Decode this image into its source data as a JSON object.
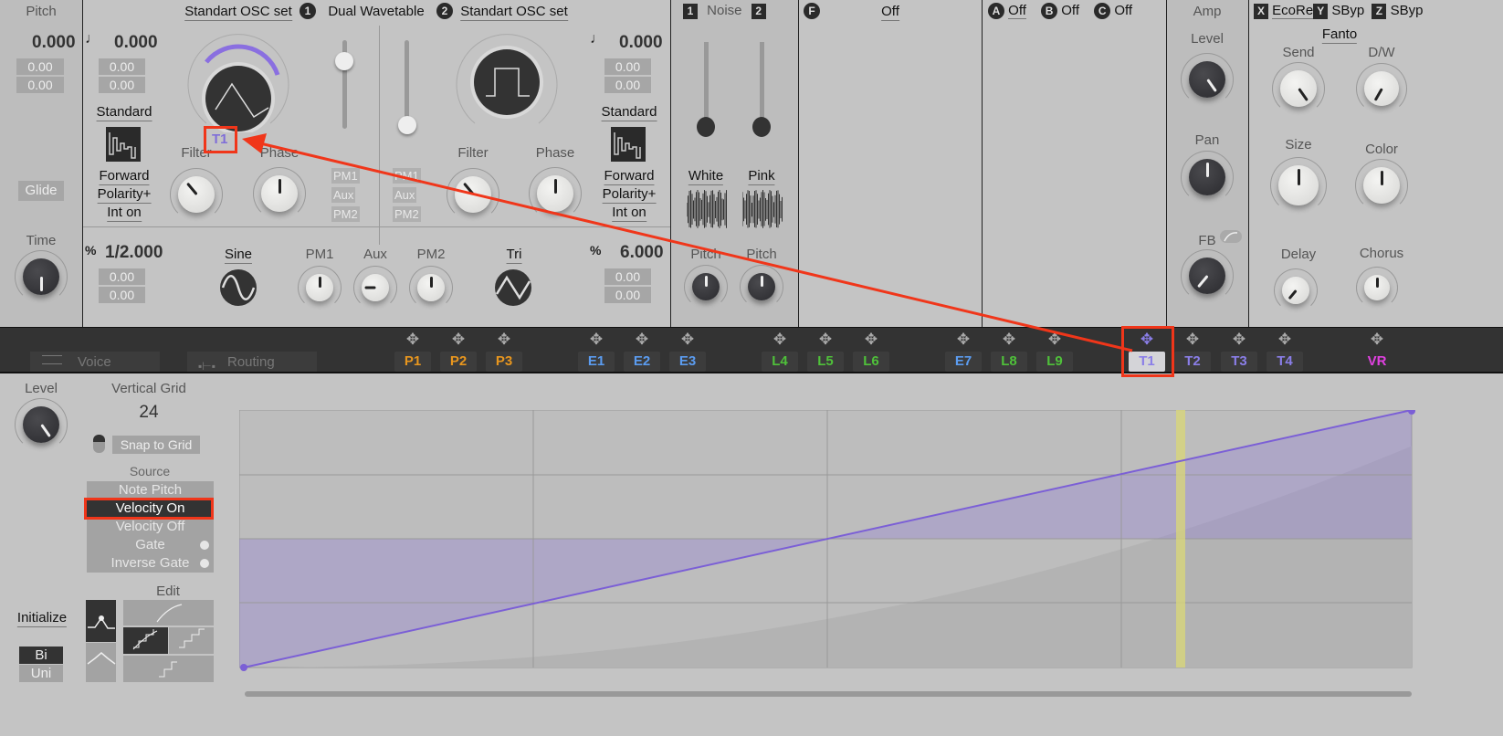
{
  "pitch": {
    "title": "Pitch",
    "value": "0.000",
    "fine1": "0.00",
    "fine2": "0.00",
    "glide": "Glide",
    "time": "Time"
  },
  "osc_header": {
    "osc1_set": "Standart OSC set",
    "num1": "1",
    "mode": "Dual Wavetable",
    "num2": "2",
    "osc2_set": "Standart OSC set"
  },
  "osc1": {
    "note_icon": "♩",
    "value": "0.000",
    "fine1": "0.00",
    "fine2": "0.00",
    "type": "Standard",
    "direction": "Forward",
    "polarity": "Polarity+",
    "interp": "Int on",
    "mod_label": "T1",
    "filter": "Filter",
    "phase": "Phase",
    "pct_icon": "%",
    "ratio": "1/2.000",
    "rfine1": "0.00",
    "rfine2": "0.00"
  },
  "osc2": {
    "note_icon": "♩",
    "value": "0.000",
    "fine1": "0.00",
    "fine2": "0.00",
    "type": "Standard",
    "direction": "Forward",
    "polarity": "Polarity+",
    "interp": "Int on",
    "filter": "Filter",
    "phase": "Phase",
    "pct_icon": "%",
    "ratio": "6.000",
    "rfine1": "0.00",
    "rfine2": "0.00"
  },
  "tags1": [
    "PM1",
    "Aux",
    "PM2"
  ],
  "tags2": [
    "PM1",
    "Aux",
    "PM2"
  ],
  "sub": {
    "wave1": "Sine",
    "pm1": "PM1",
    "aux": "Aux",
    "pm2": "PM2",
    "wave2": "Tri"
  },
  "noise": {
    "n1": "1",
    "title": "Noise",
    "n2": "2",
    "white": "White",
    "pink": "Pink",
    "pitch1": "Pitch",
    "pitch2": "Pitch"
  },
  "filter": {
    "badge": "F",
    "value": "Off"
  },
  "inserts": [
    {
      "badge": "A",
      "value": "Off"
    },
    {
      "badge": "B",
      "value": "Off"
    },
    {
      "badge": "C",
      "value": "Off"
    }
  ],
  "amp": {
    "title": "Amp",
    "level": "Level",
    "pan": "Pan",
    "fb": "FB"
  },
  "fx": {
    "x": "X",
    "x_name": "EcoRe",
    "y": "Y",
    "y_name": "SByp",
    "z": "Z",
    "z_name": "SByp",
    "preset": "Fanto",
    "send": "Send",
    "dw": "D/W",
    "size": "Size",
    "color": "Color",
    "delay": "Delay",
    "chorus": "Chorus"
  },
  "tabs": [
    {
      "label": "Voice",
      "icon": "menu-icon"
    },
    {
      "label": "Routing",
      "icon": "routing-icon"
    }
  ],
  "mod_slots": [
    {
      "label": "P1",
      "color": "#e8961e"
    },
    {
      "label": "P2",
      "color": "#e8961e"
    },
    {
      "label": "P3",
      "color": "#e8961e"
    },
    {
      "label": "E1",
      "color": "#5b9cf0"
    },
    {
      "label": "E2",
      "color": "#5b9cf0"
    },
    {
      "label": "E3",
      "color": "#5b9cf0"
    },
    {
      "label": "L4",
      "color": "#4fc13a"
    },
    {
      "label": "L5",
      "color": "#4fc13a"
    },
    {
      "label": "L6",
      "color": "#4fc13a"
    },
    {
      "label": "E7",
      "color": "#5b9cf0"
    },
    {
      "label": "L8",
      "color": "#4fc13a"
    },
    {
      "label": "L9",
      "color": "#4fc13a"
    },
    {
      "label": "T1",
      "color": "#8a7ee8",
      "selected": true
    },
    {
      "label": "T2",
      "color": "#8a7ee8"
    },
    {
      "label": "T3",
      "color": "#8a7ee8"
    },
    {
      "label": "T4",
      "color": "#8a7ee8"
    },
    {
      "label": "VR",
      "color": "#e040e0"
    }
  ],
  "editor": {
    "level": "Level",
    "vgrid_label": "Vertical Grid",
    "vgrid_value": "24",
    "snap": "Snap to Grid",
    "source_label": "Source",
    "sources": [
      {
        "label": "Note Pitch"
      },
      {
        "label": "Velocity On",
        "selected": true
      },
      {
        "label": "Velocity Off"
      },
      {
        "label": "Gate",
        "dot": true
      },
      {
        "label": "Inverse Gate",
        "dot": true
      }
    ],
    "edit_label": "Edit",
    "initialize": "Initialize",
    "bi": "Bi",
    "uni": "Uni"
  },
  "colors": {
    "accent": "#8a6fe0",
    "annotation": "#f0361a",
    "line": "#7b5fd6",
    "marker": "#d8d67a"
  }
}
